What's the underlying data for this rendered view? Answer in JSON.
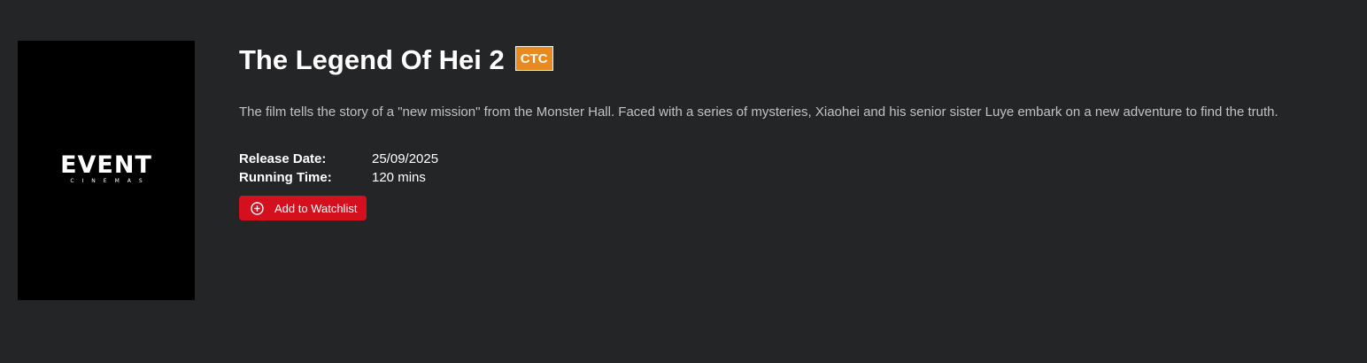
{
  "movie": {
    "title": "The Legend Of Hei 2",
    "rating": "CTC",
    "synopsis": "The film tells the story of a \"new mission\" from the Monster Hall. Faced with a series of mysteries, Xiaohei and his senior sister Luye embark on a new adventure to find the truth.",
    "poster": {
      "logo_main": "EVENT",
      "logo_sub": "CINEMAS"
    },
    "release_date_label": "Release Date:",
    "release_date": "25/09/2025",
    "running_time_label": "Running Time:",
    "running_time": "120 mins",
    "watchlist_label": "Add to Watchlist"
  },
  "colors": {
    "background": "#242527",
    "rating_badge": "#e88a1f",
    "button": "#d4101f"
  },
  "icons": {
    "watchlist": "plus-circle-icon"
  }
}
